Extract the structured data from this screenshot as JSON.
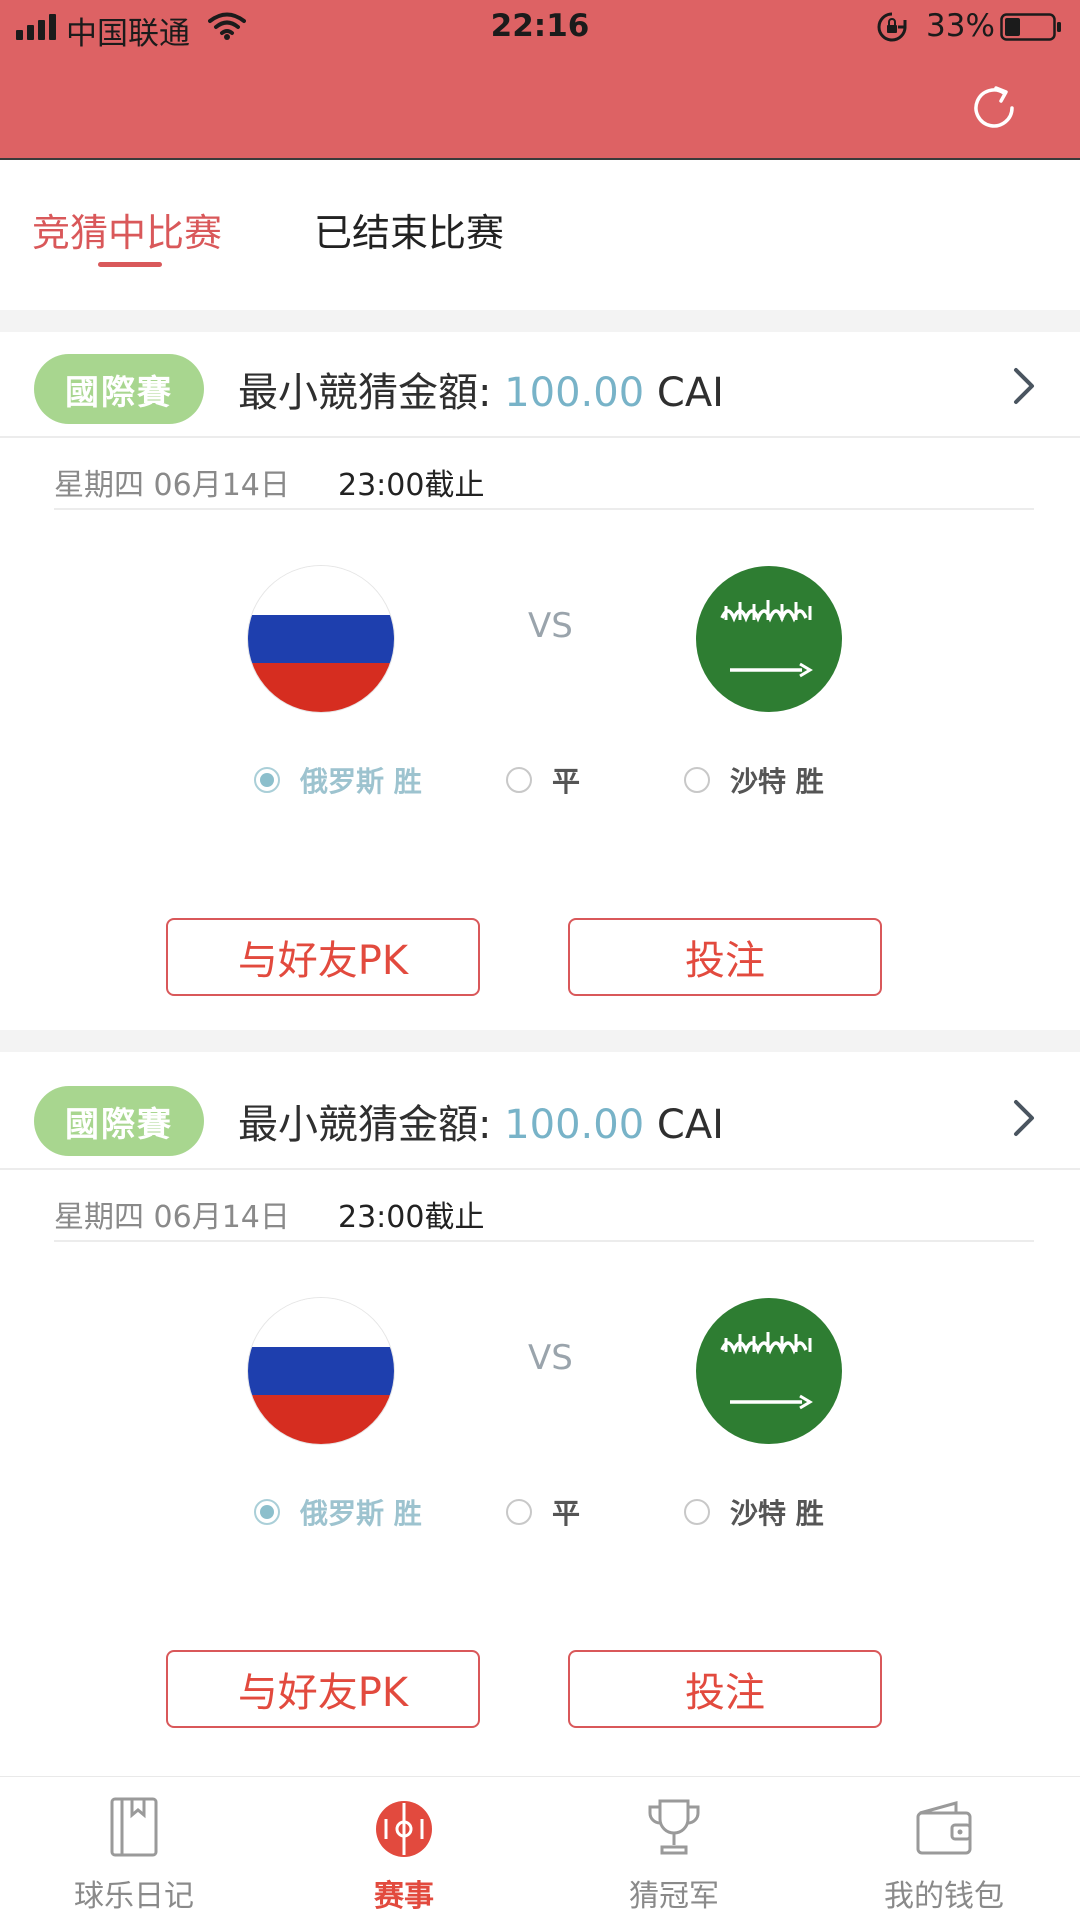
{
  "status_bar": {
    "carrier": "中国联通",
    "time": "22:16",
    "battery_percent": "33%",
    "battery_level": 0.33,
    "icons": [
      "signal-icon",
      "wifi-icon",
      "rotation-lock-icon",
      "battery-icon"
    ]
  },
  "header": {
    "refresh_icon": "refresh-icon"
  },
  "tabs": [
    {
      "label": "竞猜中比赛",
      "active": true
    },
    {
      "label": "已结束比赛",
      "active": false
    }
  ],
  "matches": [
    {
      "league": "國際賽",
      "min_bet_label": "最小競猜金額:",
      "min_bet_amount": "100.00",
      "currency": "CAI",
      "date": "星期四 06月14日",
      "deadline": "23:00截止",
      "home_team_flag": "russia-flag",
      "away_team_flag": "saudi-arabia-flag",
      "vs": "VS",
      "options": [
        {
          "label": "俄罗斯 胜",
          "selected": true
        },
        {
          "label": "平",
          "selected": false
        },
        {
          "label": "沙特 胜",
          "selected": false
        }
      ],
      "pk_button": "与好友PK",
      "bet_button": "投注"
    },
    {
      "league": "國際賽",
      "min_bet_label": "最小競猜金額:",
      "min_bet_amount": "100.00",
      "currency": "CAI",
      "date": "星期四 06月14日",
      "deadline": "23:00截止",
      "home_team_flag": "russia-flag",
      "away_team_flag": "saudi-arabia-flag",
      "vs": "VS",
      "options": [
        {
          "label": "俄罗斯 胜",
          "selected": true
        },
        {
          "label": "平",
          "selected": false
        },
        {
          "label": "沙特 胜",
          "selected": false
        }
      ],
      "pk_button": "与好友PK",
      "bet_button": "投注"
    }
  ],
  "bottom_nav": [
    {
      "label": "球乐日记",
      "icon": "diary-book-icon",
      "active": false
    },
    {
      "label": "赛事",
      "icon": "match-ball-icon",
      "active": true
    },
    {
      "label": "猜冠军",
      "icon": "trophy-icon",
      "active": false
    },
    {
      "label": "我的钱包",
      "icon": "wallet-icon",
      "active": false
    }
  ],
  "colors": {
    "header_bg": "#dd6264",
    "accent_red": "#d9585a",
    "button_text": "#e24a3e",
    "badge_green": "#a8d68f",
    "amount_blue": "#78b3c8"
  }
}
